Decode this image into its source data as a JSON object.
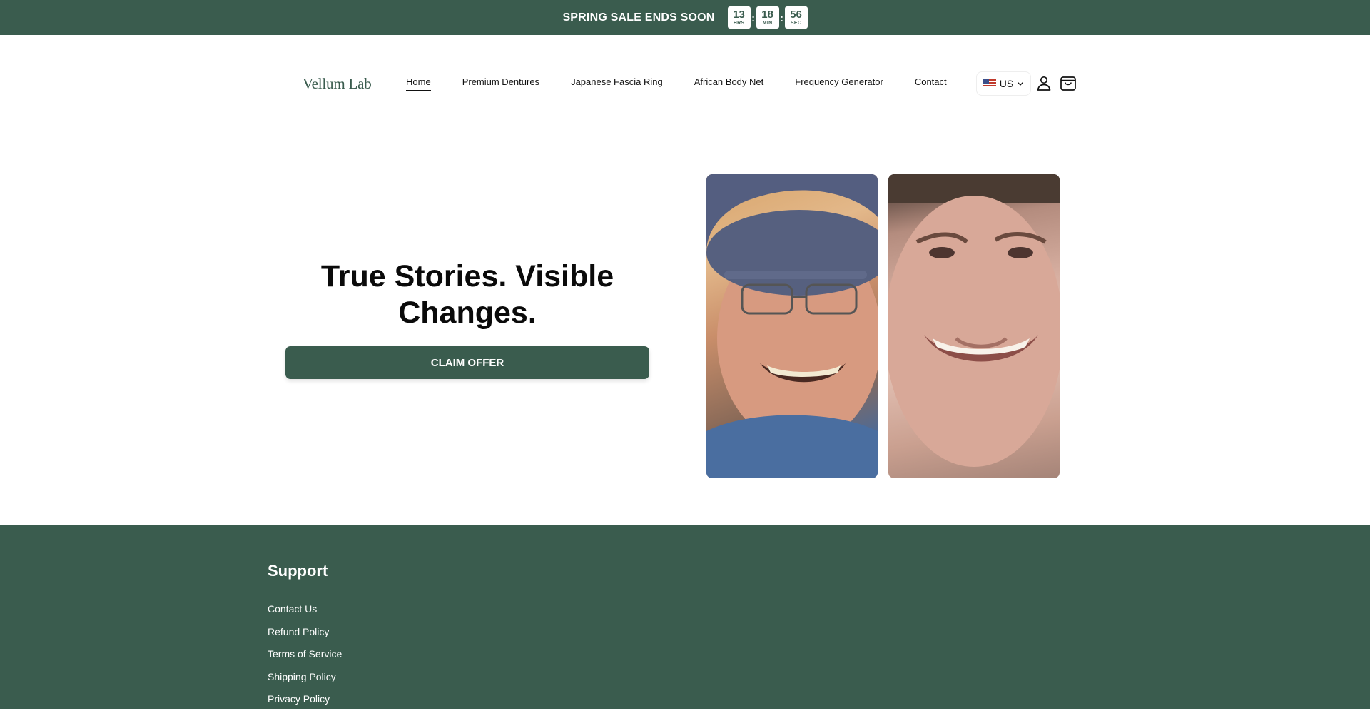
{
  "announcement": {
    "text": "SPRING SALE ENDS SOON",
    "timer": [
      {
        "value": "13",
        "label": "HRS"
      },
      {
        "value": "18",
        "label": "MIN"
      },
      {
        "value": "56",
        "label": "SEC"
      }
    ],
    "separator": ":"
  },
  "header": {
    "logo": "Vellum Lab",
    "nav": [
      {
        "label": "Home",
        "active": true
      },
      {
        "label": "Premium Dentures"
      },
      {
        "label": "Japanese Fascia Ring"
      },
      {
        "label": "African Body Net"
      },
      {
        "label": "Frequency Generator"
      },
      {
        "label": "Contact"
      }
    ],
    "locale": {
      "label": "US",
      "icon": "us-flag-icon"
    },
    "account_icon": "user-icon",
    "cart_icon": "shopping-bag-icon"
  },
  "hero": {
    "title": "True Stories. Visible Changes.",
    "cta_label": "CLAIM OFFER"
  },
  "footer": {
    "heading": "Support",
    "links": [
      "Contact Us",
      "Refund Policy",
      "Terms of Service",
      "Shipping Policy",
      "Privacy Policy"
    ]
  },
  "colors": {
    "brand_green": "#3a5c4e",
    "text": "#111111",
    "background": "#ffffff"
  }
}
